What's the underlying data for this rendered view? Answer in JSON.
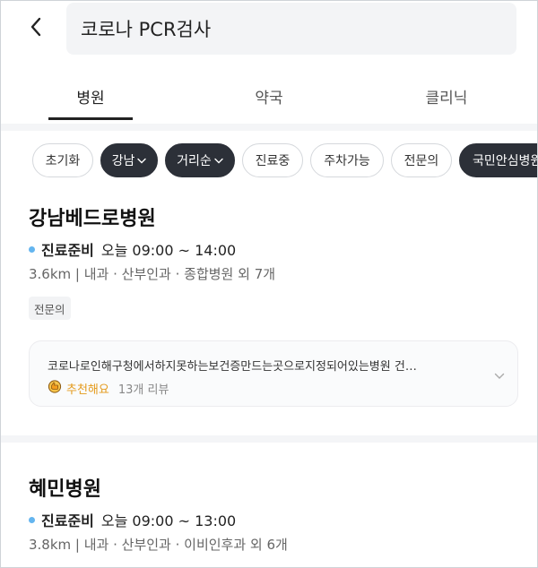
{
  "search": {
    "query": "코로나 PCR검사"
  },
  "tabs": [
    {
      "label": "병원",
      "active": true
    },
    {
      "label": "약국",
      "active": false
    },
    {
      "label": "클리닉",
      "active": false
    }
  ],
  "filters": [
    {
      "label": "초기화",
      "dark": false,
      "caret": false
    },
    {
      "label": "강남",
      "dark": true,
      "caret": true
    },
    {
      "label": "거리순",
      "dark": true,
      "caret": true
    },
    {
      "label": "진료중",
      "dark": false,
      "caret": false
    },
    {
      "label": "주차가능",
      "dark": false,
      "caret": false
    },
    {
      "label": "전문의",
      "dark": false,
      "caret": false
    },
    {
      "label": "국민안심병원",
      "dark": true,
      "caret": false
    }
  ],
  "hospitals": [
    {
      "name": "강남베드로병원",
      "status": "진료준비",
      "hours": "오늘 09:00 ~ 14:00",
      "meta": "3.6km | 내과 · 산부인과 · 종합병원 외 7개",
      "tag": "전문의",
      "review": {
        "text": "코로나로인해구청에서하지못하는보건증만드는곳으로지정되어있는병원 건…",
        "recommend": "추천해요",
        "count": "13개 리뷰"
      }
    },
    {
      "name": "혜민병원",
      "status": "진료준비",
      "hours": "오늘 09:00 ~ 13:00",
      "meta": "3.8km | 내과 · 산부인과 · 이비인후과 외 6개"
    }
  ],
  "colors": {
    "status_dot": "#64b5ef",
    "recommend": "#e49a1b",
    "chip_dark": "#2c3038"
  }
}
